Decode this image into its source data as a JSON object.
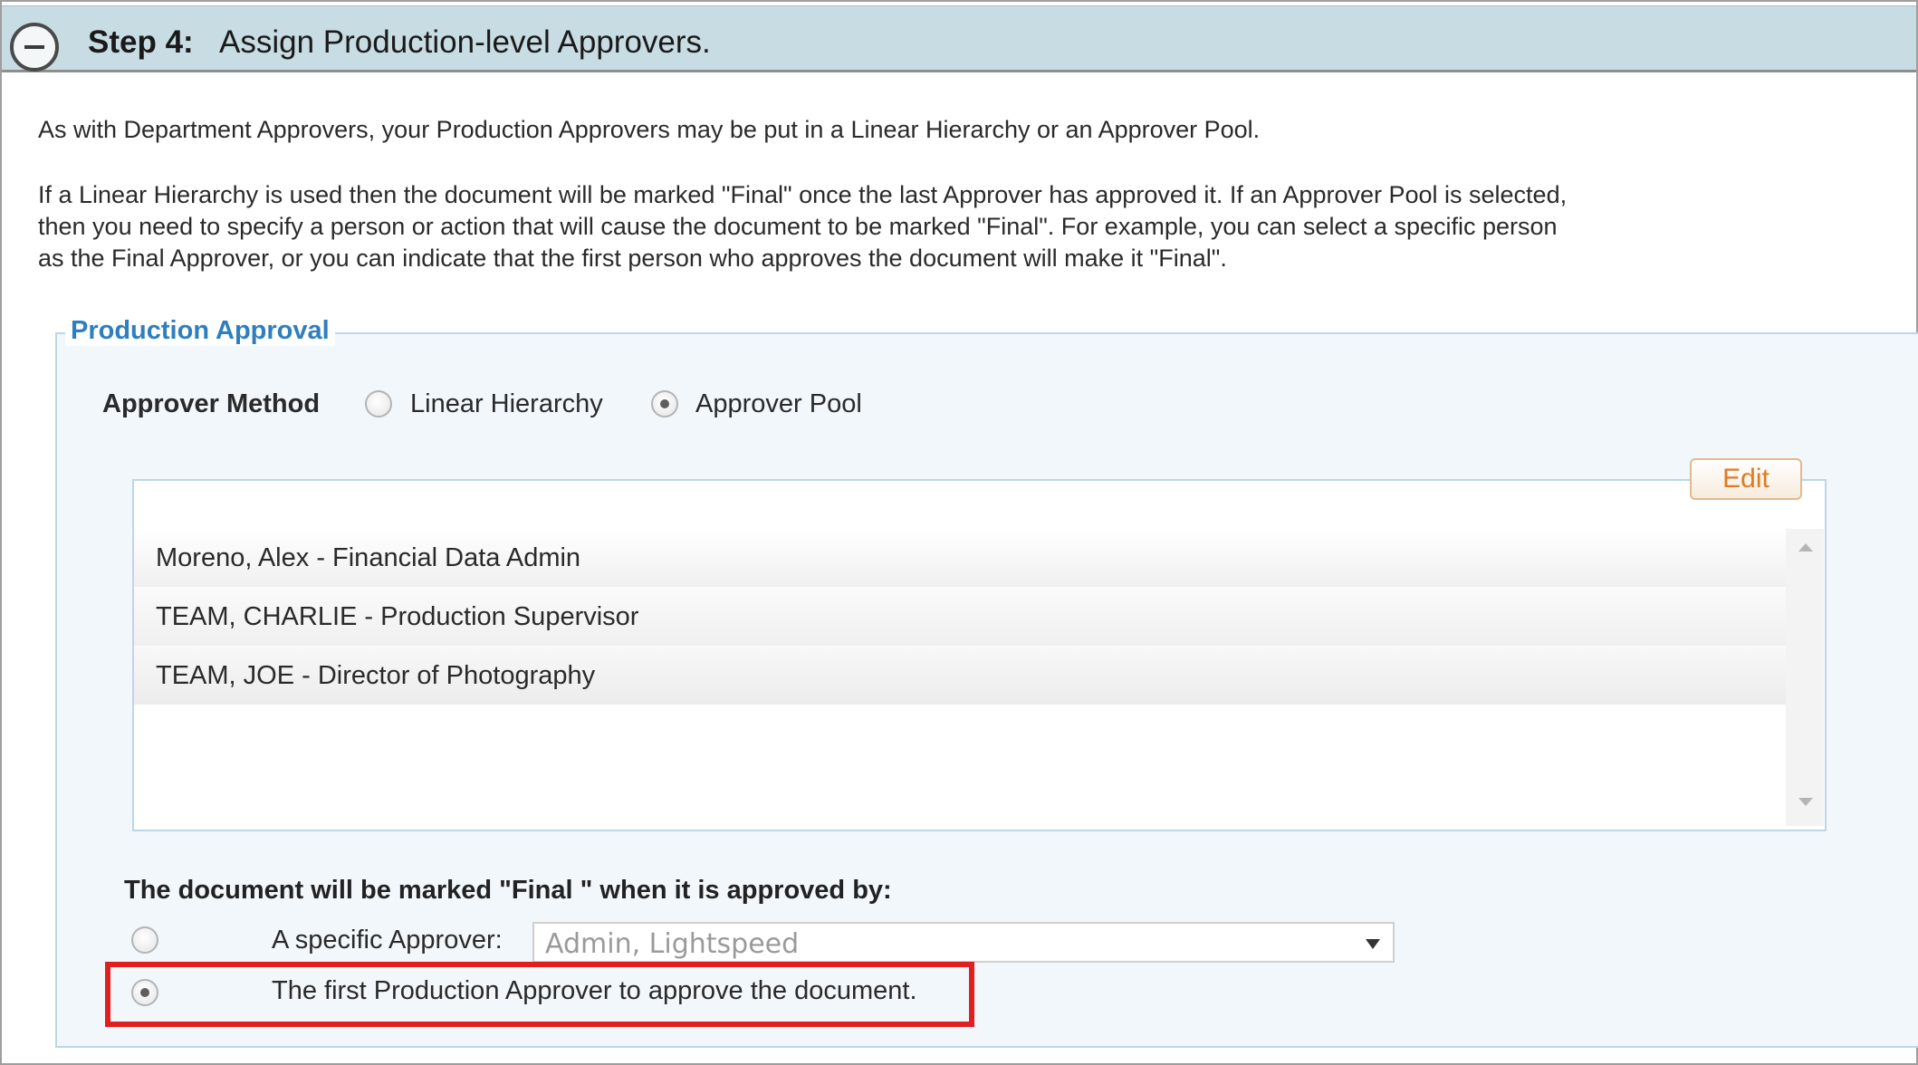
{
  "step": {
    "label": "Step 4:",
    "title": "Assign Production-level Approvers."
  },
  "intro": {
    "line1": "As with Department Approvers, your Production Approvers may be put in a Linear Hierarchy or an Approver Pool.",
    "line2a": "If a Linear Hierarchy is used then the document will be marked \"Final\" once the last Approver has approved it. If an Approver Pool is selected,",
    "line2b": "then you need to specify a person or action that will cause the document to be marked \"Final\". For example, you can select a specific person",
    "line2c": "as the Final Approver, or you can indicate that the first person who approves the document will make it \"Final\"."
  },
  "production_approval": {
    "legend": "Production Approval",
    "method_label": "Approver Method",
    "method_options": [
      {
        "label": "Linear Hierarchy",
        "selected": false
      },
      {
        "label": "Approver Pool",
        "selected": true
      }
    ],
    "edit_label": "Edit",
    "approvers": [
      "Moreno, Alex - Financial Data Admin",
      "TEAM, CHARLIE - Production Supervisor",
      "TEAM, JOE - Director of Photography"
    ],
    "final_label": "The document will be marked \"Final \" when it is approved by:",
    "final_options": {
      "specific_label": "A specific Approver:",
      "specific_selected": false,
      "specific_value": "Admin, Lightspeed",
      "first_label": "The first Production Approver to approve the document.",
      "first_selected": true
    }
  },
  "colors": {
    "header_bg": "#c8dce3",
    "legend": "#2f7fbf",
    "edit_text": "#e07a20",
    "highlight": "#e02020"
  }
}
